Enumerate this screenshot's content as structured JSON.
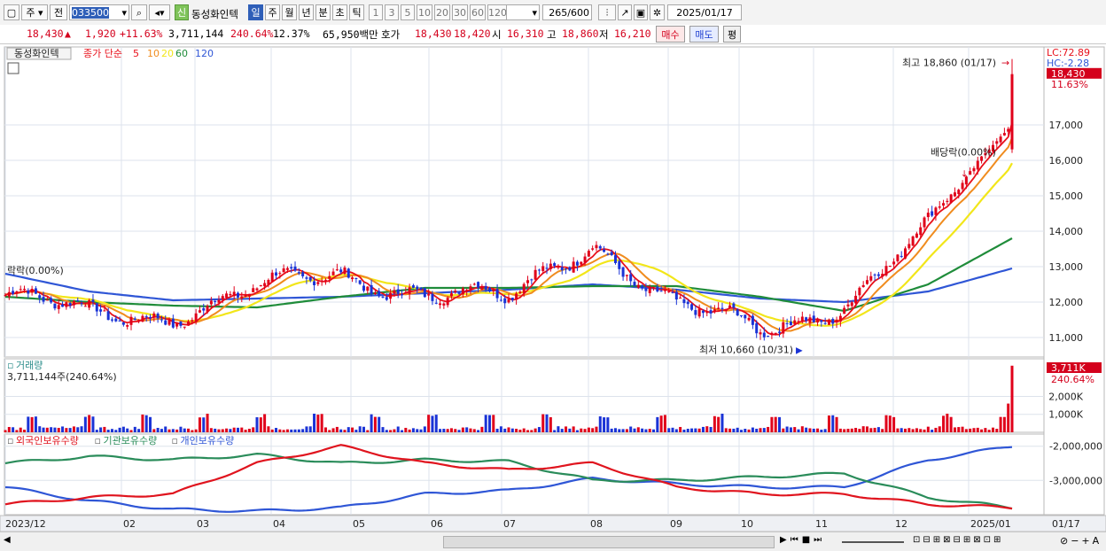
{
  "toolbar": {
    "mode_label": "주",
    "prev_label": "전",
    "code": "033500",
    "new_badge": "신",
    "stock_name": "동성화인텍",
    "periods": [
      "일",
      "주",
      "월",
      "년",
      "분",
      "초",
      "틱"
    ],
    "active_period": "일",
    "intervals": [
      "1",
      "3",
      "5",
      "10",
      "20",
      "30",
      "60",
      "120"
    ],
    "count_value": "265",
    "count_total": "/600",
    "date": "2025/01/17"
  },
  "infobar": {
    "price": "18,430",
    "up_arrow": "▲",
    "change": "1,920",
    "change_pct": "+11.63%",
    "volume": "3,711,144",
    "volume_ratio": "240.64%",
    "turnover": "12.37%",
    "amount": "65,950백만",
    "quote_label": "호가",
    "ask": "18,430",
    "bid": "18,420",
    "open_label": "시",
    "open": "16,310",
    "high_label": "고",
    "high": "18,860",
    "low_label": "저",
    "low": "16,210",
    "buy_label": "매수",
    "sell_label": "매도",
    "avg_label": "평"
  },
  "price_panel": {
    "name_label": "동성화인텍",
    "ma_label": "종가 단순",
    "ma_periods": [
      "5",
      "10",
      "20",
      "60",
      "120"
    ],
    "lc": "LC:72.89",
    "hc": "HC:-2.28",
    "last_price_tag": "18,430",
    "last_pct_tag": "11.63%",
    "high_annotation": "최고 18,860 (01/17)",
    "low_annotation": "최저 10,660 (10/31)",
    "dividend_annotation": "배당락(0.00%)",
    "left_annotation": "락락(0.00%)",
    "y_ticks": [
      "17,000",
      "16,000",
      "15,000",
      "14,000",
      "13,000",
      "12,000",
      "11,000"
    ]
  },
  "volume_panel": {
    "title": "거래량",
    "value_line": "3,711,144주(240.64%)",
    "tag": "3,711K",
    "tag_pct": "240.64%",
    "y_ticks": [
      "2,000K",
      "1,000K"
    ]
  },
  "holding_panel": {
    "legend": [
      "외국인보유수량",
      "기관보유수량",
      "개인보유수량"
    ],
    "y_ticks": [
      "-2,000,000",
      "-3,000,000"
    ]
  },
  "x_axis": {
    "labels": [
      "2023/12",
      "02",
      "03",
      "04",
      "05",
      "06",
      "07",
      "08",
      "09",
      "10",
      "11",
      "12",
      "2025/01",
      "01/17"
    ]
  },
  "colors": {
    "up": "#e0001a",
    "down": "#1a33d6",
    "ma5": "#e8101a",
    "ma10": "#f08c1e",
    "ma20": "#f2e61a",
    "ma60": "#1f8c3a",
    "ma120": "#2f56d6",
    "foreign": "#e0141e",
    "institution": "#2a8c5a",
    "individual": "#2f56d6"
  },
  "chart_data": {
    "type": "candlestick",
    "x": [
      "2023/12",
      "02",
      "03",
      "04",
      "05",
      "06",
      "07",
      "08",
      "09",
      "10",
      "11",
      "12",
      "2025/01"
    ],
    "close_approx": [
      12200,
      11600,
      11700,
      12300,
      12800,
      12300,
      12000,
      13800,
      11800,
      11200,
      12000,
      14000,
      16700
    ],
    "ma120_approx": [
      12800,
      12300,
      12050,
      12100,
      12150,
      12250,
      12350,
      12500,
      12350,
      12100,
      12000,
      12300,
      12950
    ],
    "ma60_approx": [
      12150,
      12000,
      11900,
      11850,
      12150,
      12400,
      12400,
      12450,
      12450,
      12150,
      11750,
      12500,
      13800
    ],
    "last_close": 18430,
    "high": 18860,
    "low": 10660,
    "ylim": [
      10500,
      18900
    ],
    "volume_last_k": 3711,
    "volume_ylim_k": [
      0,
      3800
    ],
    "holdings": {
      "foreign": [
        -3700000,
        -3500000,
        -3400000,
        -2500000,
        -2000000,
        -2500000,
        -2700000,
        -2500000,
        -3200000,
        -3400000,
        -3400000,
        -3700000,
        -3800000
      ],
      "institution": [
        -2500000,
        -2300000,
        -2400000,
        -2250000,
        -2500000,
        -2400000,
        -2450000,
        -3000000,
        -3000000,
        -2900000,
        -2800000,
        -3500000,
        -3800000
      ],
      "individual": [
        -3200000,
        -3600000,
        -3850000,
        -3900000,
        -3800000,
        -3400000,
        -3300000,
        -2950000,
        -3100000,
        -3200000,
        -3200000,
        -2400000,
        -2000000
      ]
    },
    "holding_ylim": [
      -3900000,
      -1800000
    ]
  }
}
